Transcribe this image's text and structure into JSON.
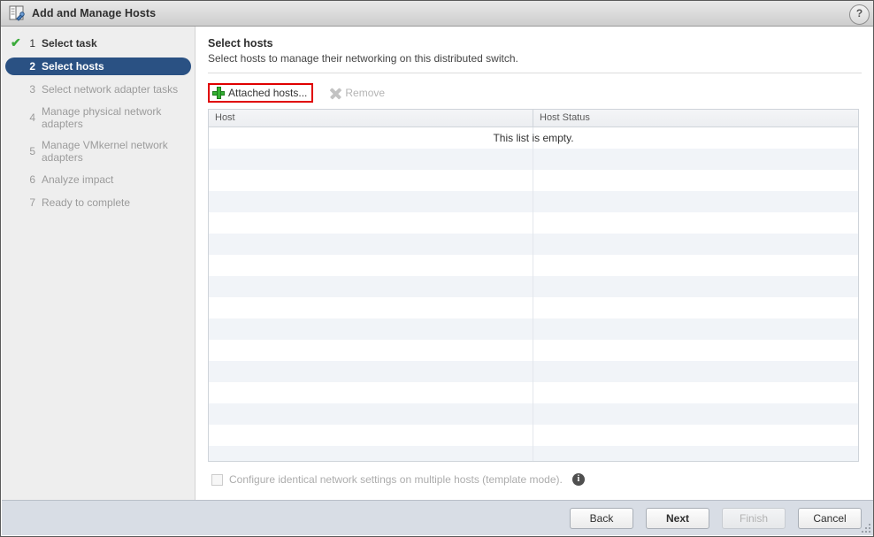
{
  "window": {
    "title": "Add and Manage Hosts",
    "title_icon": "host-wizard-icon",
    "help_label": "?"
  },
  "steps": [
    {
      "num": "1",
      "label": "Select task",
      "state": "done"
    },
    {
      "num": "2",
      "label": "Select hosts",
      "state": "active"
    },
    {
      "num": "3",
      "label": "Select network adapter tasks",
      "state": "pending"
    },
    {
      "num": "4",
      "label": "Manage physical network adapters",
      "state": "pending"
    },
    {
      "num": "5",
      "label": "Manage VMkernel network adapters",
      "state": "pending"
    },
    {
      "num": "6",
      "label": "Analyze impact",
      "state": "pending"
    },
    {
      "num": "7",
      "label": "Ready to complete",
      "state": "pending"
    }
  ],
  "page": {
    "title": "Select hosts",
    "subtitle": "Select hosts to manage their networking on this distributed switch."
  },
  "toolbar": {
    "attached_hosts_label": "Attached hosts...",
    "remove_label": "Remove",
    "highlight_color": "#e00000"
  },
  "table": {
    "columns": [
      "Host",
      "Host Status"
    ],
    "empty_message": "This list is empty.",
    "rows": []
  },
  "option": {
    "checkbox_label": "Configure identical network settings on multiple hosts (template mode).",
    "checked": false,
    "info_glyph": "i"
  },
  "buttons": {
    "back": "Back",
    "next": "Next",
    "finish": "Finish",
    "cancel": "Cancel"
  }
}
